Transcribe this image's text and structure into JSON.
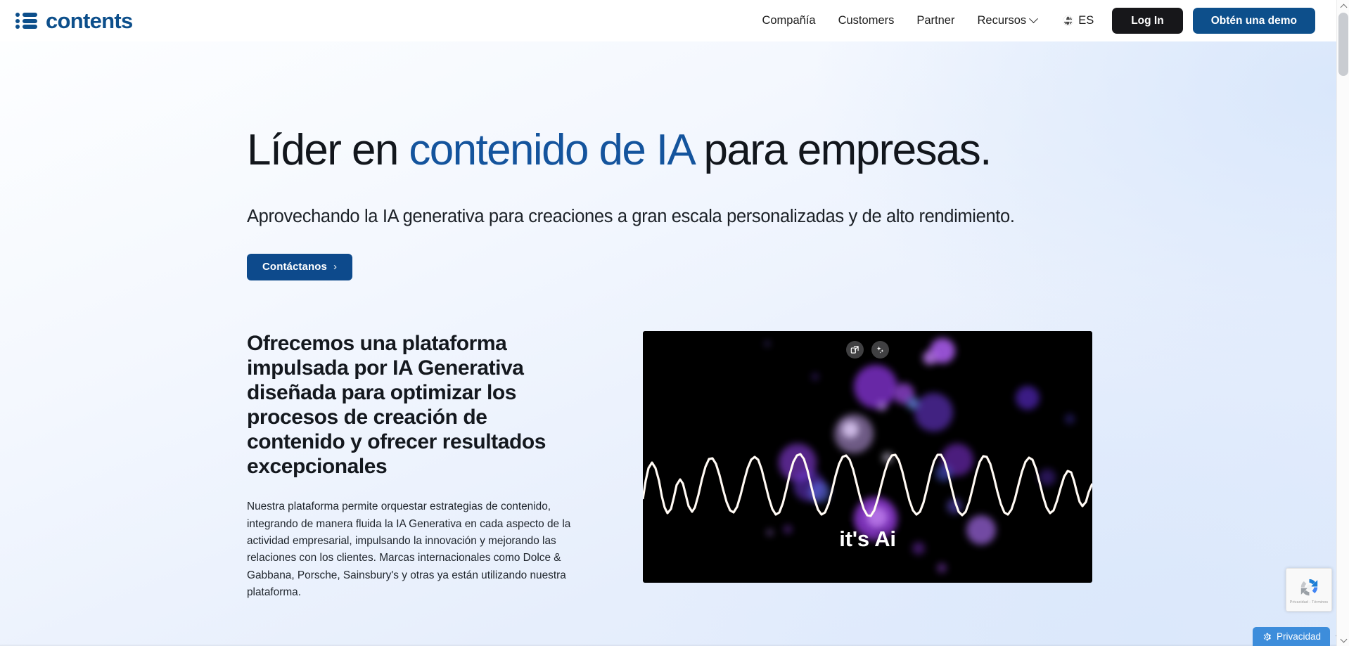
{
  "brand": {
    "name": "contents",
    "logo_icon": "list-icon",
    "color": "#0d4f8b"
  },
  "header": {
    "nav": [
      {
        "label": "Compañía",
        "has_dropdown": false
      },
      {
        "label": "Customers",
        "has_dropdown": false
      },
      {
        "label": "Partner",
        "has_dropdown": false
      },
      {
        "label": "Recursos",
        "has_dropdown": true
      }
    ],
    "language": {
      "icon": "globe-icon",
      "label": "ES"
    },
    "login_label": "Log In",
    "demo_label": "Obtén una demo",
    "login_color": "#17171a",
    "demo_color": "#0d4f8b"
  },
  "hero": {
    "title_part1": "Líder en ",
    "title_accent": "contenido de IA",
    "title_part2": " para empresas.",
    "accent_color": "#14549d",
    "subtitle": "Aprovechando la IA generativa para creaciones a gran escala personalizadas y de alto rendimiento.",
    "cta_label": "Contáctanos",
    "cta_arrow": "›",
    "cta_color": "#0d4a8c"
  },
  "platform_section": {
    "heading": "Ofrecemos una plataforma impulsada por IA Generativa diseñada para optimizar los procesos de creación de contenido y ofrecer resultados excepcionales",
    "body": "Nuestra plataforma permite orquestar estrategias de contenido, integrando de manera fluida la IA Generativa en cada aspecto de la actividad empresarial, impulsando la innovación y mejorando las relaciones con los clientes. Marcas internacionales como Dolce & Gabbana, Porsche, Sainsbury's y otras ya están utilizando nuestra plataforma."
  },
  "media": {
    "caption": "it's Ai",
    "background_color": "#000000",
    "accent_color": "#8b3ede",
    "tools": [
      {
        "icon": "expand-icon",
        "name": "open-in-new-window"
      },
      {
        "icon": "sparkles-icon",
        "name": "ai-enhance"
      }
    ]
  },
  "recaptcha": {
    "icon": "recaptcha-icon",
    "text": "Privacidad - Términos"
  },
  "privacy": {
    "label": "Privacidad",
    "icon": "gear-icon",
    "color": "#3d8ddb",
    "collapse_icon": "chevron-down-icon"
  },
  "scrollbar": {
    "up_icon": "chevron-up-icon",
    "down_icon": "chevron-down-icon"
  }
}
